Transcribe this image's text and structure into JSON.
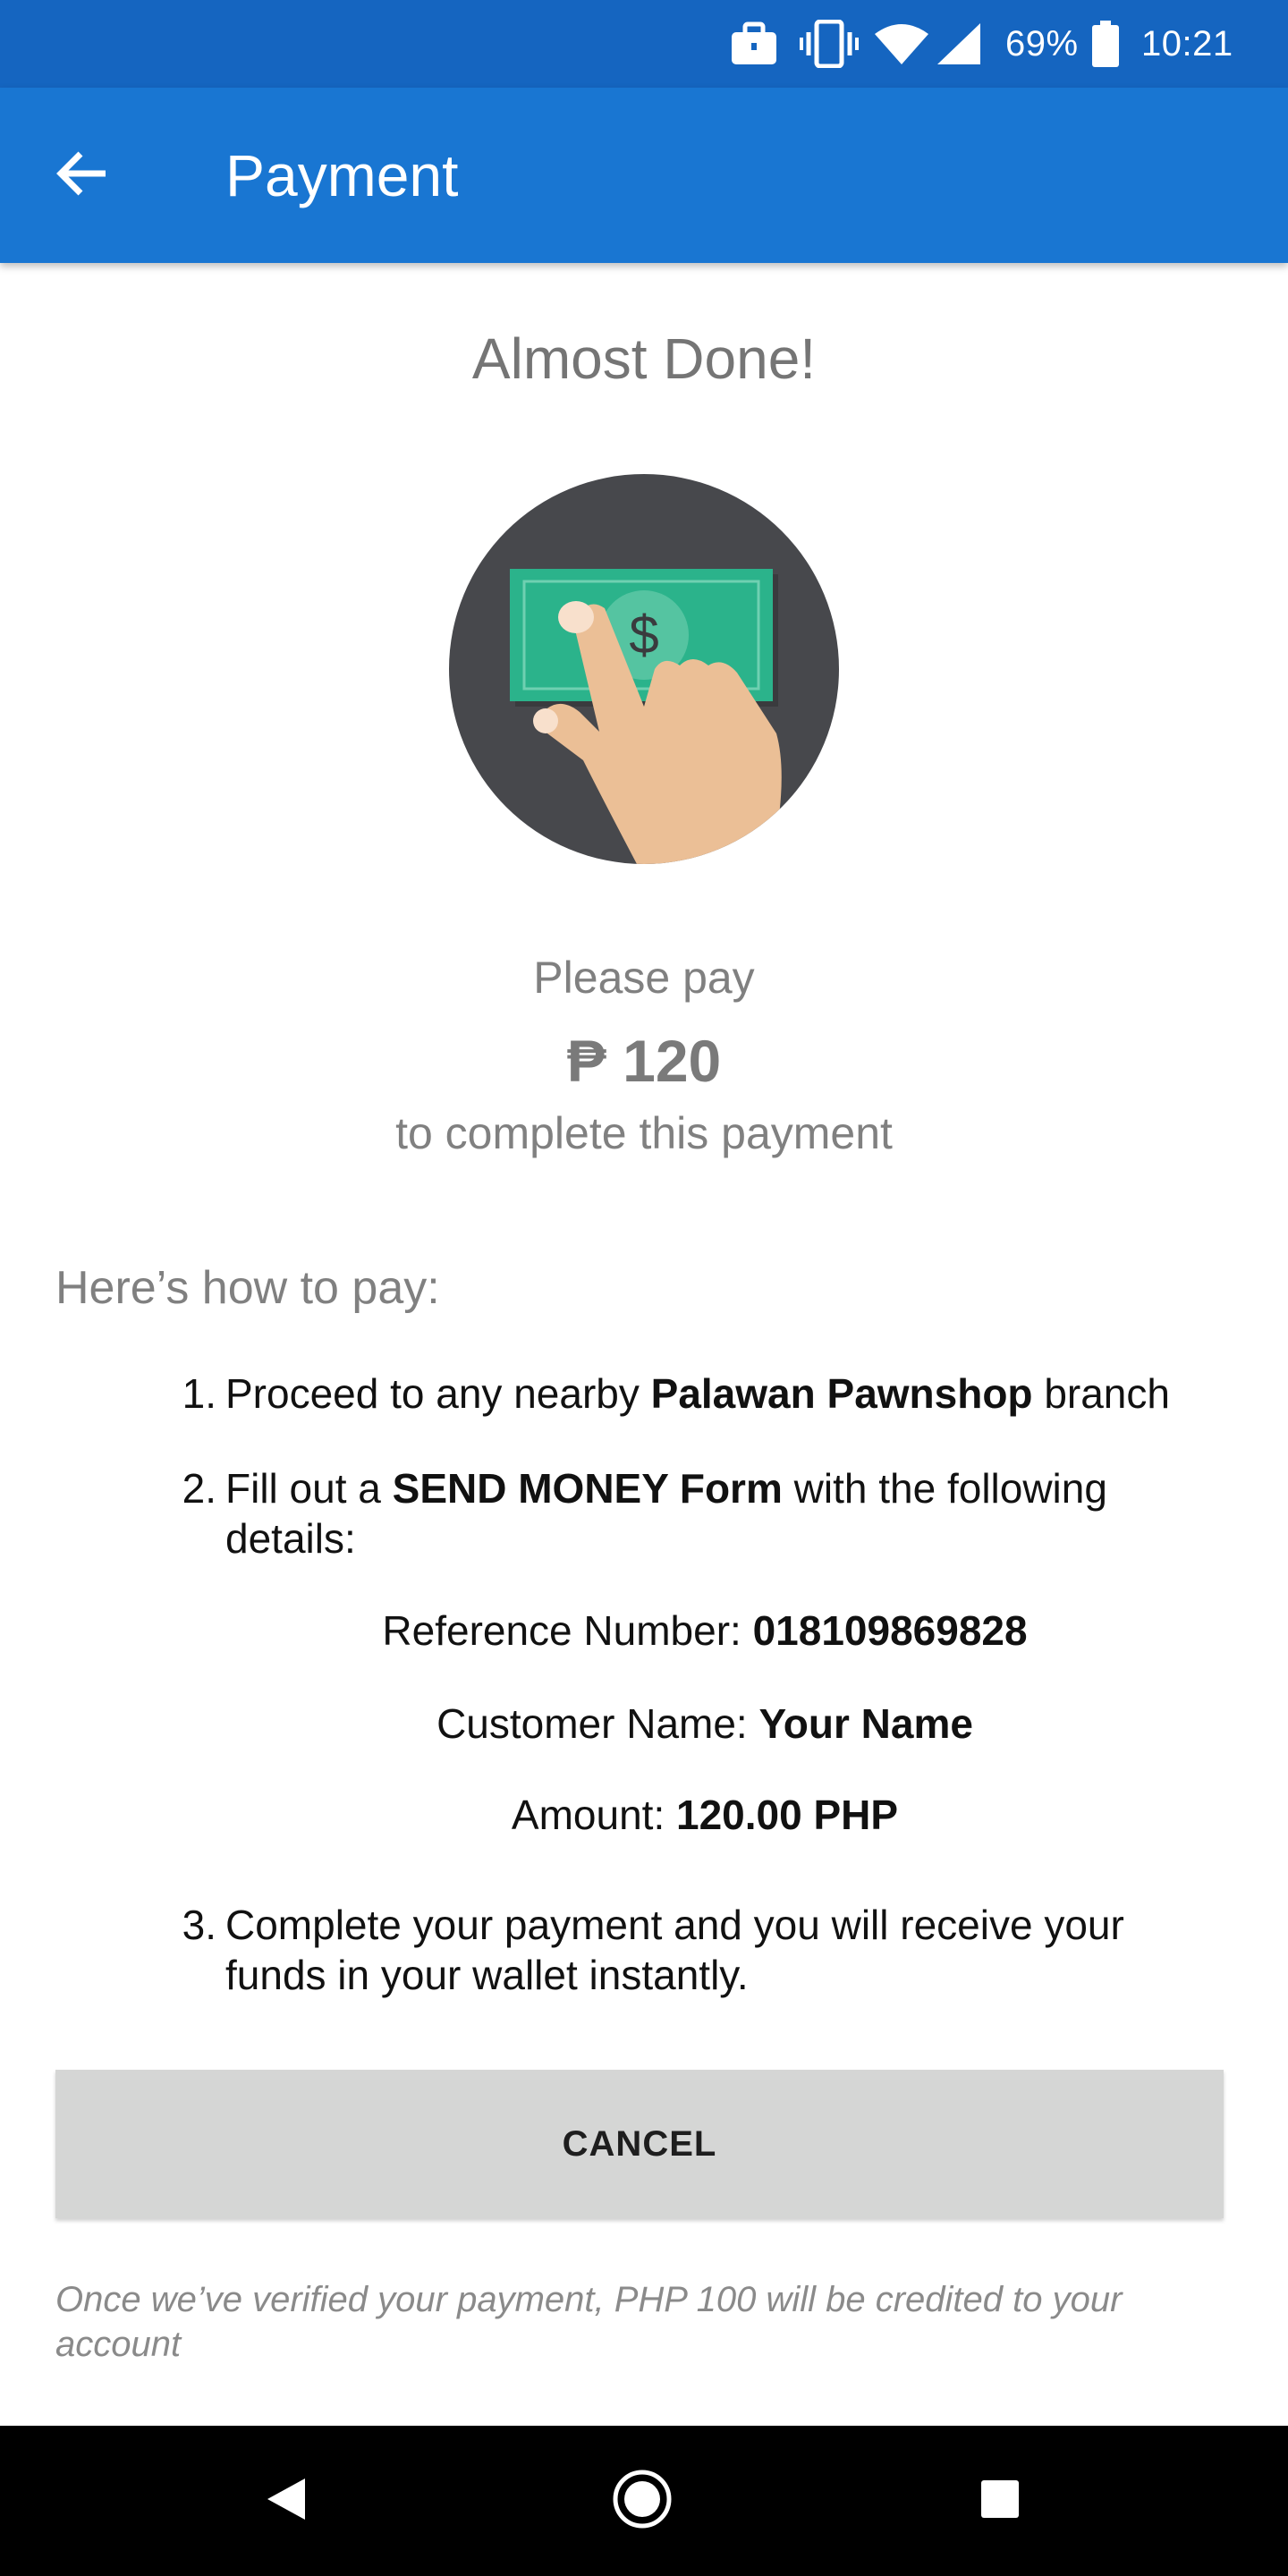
{
  "status_bar": {
    "battery_percent": "69%",
    "time": "10:21",
    "icons": [
      "briefcase-icon",
      "vibrate-icon",
      "wifi-icon",
      "cell-signal-icon",
      "battery-icon"
    ]
  },
  "app_bar": {
    "title": "Payment",
    "back_icon": "arrow-back-icon"
  },
  "headline": "Almost Done!",
  "illustration": "hand-tapping-dollar-bill-icon",
  "pay": {
    "prefix": "Please pay",
    "amount": "₱ 120",
    "suffix": "to complete this payment"
  },
  "howto_title": "Here’s how to pay:",
  "steps": [
    {
      "num": "1.",
      "before": "Proceed to any nearby ",
      "bold": "Palawan Pawnshop",
      "after": " branch"
    },
    {
      "num": "2.",
      "before": "Fill out a ",
      "bold": "SEND MONEY Form",
      "after": " with the following details:"
    },
    {
      "num": "3.",
      "text": "Complete your payment and you will receive your funds in your wallet instantly."
    }
  ],
  "details": {
    "reference_label": "Reference Number: ",
    "reference_value": "018109869828",
    "customer_label": "Customer Name: ",
    "customer_value": "Your Name",
    "amount_label": "Amount: ",
    "amount_value": "120.00 PHP"
  },
  "cancel_label": "CANCEL",
  "footnote": "Once we’ve verified your payment, PHP 100 will be credited to your account",
  "colors": {
    "status_bar": "#1565c0",
    "app_bar": "#1976d2",
    "illustration_bg": "#47484c",
    "bill_green": "#2bb38b",
    "hand_skin": "#ebbf96",
    "button_bg": "#d5d6d5"
  }
}
